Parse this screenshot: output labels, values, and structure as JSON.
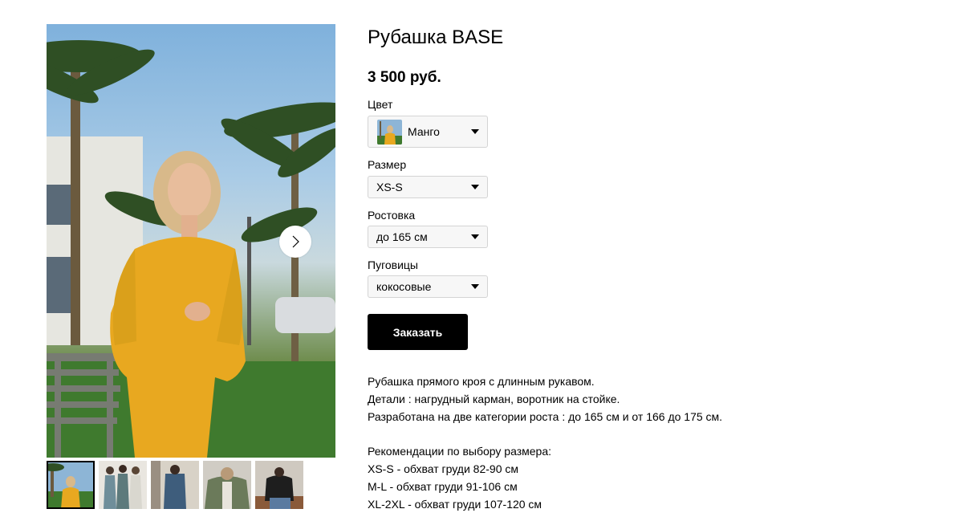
{
  "product": {
    "title": "Рубашка BASE",
    "price": "3 500 руб."
  },
  "options": {
    "color": {
      "label": "Цвет",
      "value": "Манго"
    },
    "size": {
      "label": "Размер",
      "value": "XS-S"
    },
    "height": {
      "label": "Ростовка",
      "value": "до 165 см"
    },
    "buttons": {
      "label": "Пуговицы",
      "value": "кокосовые"
    }
  },
  "order_button": "Заказать",
  "description": {
    "lines": [
      "Рубашка прямого кроя с длинным рукавом.",
      "Детали : нагрудный карман, воротник на стойке.",
      "Разработана на две категории роста : до 165 см и от 166 до 175 см."
    ],
    "size_heading": "Рекомендации по выбору размера:",
    "size_lines": [
      "XS-S - обхват груди 82-90 см",
      "M-L - обхват груди 91-106 см",
      "XL-2XL - обхват груди 107-120 см"
    ]
  },
  "icons": {
    "next": "chevron-right-icon",
    "select": "caret-down-icon"
  },
  "colors": {
    "button_bg": "#000000",
    "select_bg": "#f7f7f7",
    "select_border": "#d4d4d4",
    "mango": "#e8a820"
  }
}
